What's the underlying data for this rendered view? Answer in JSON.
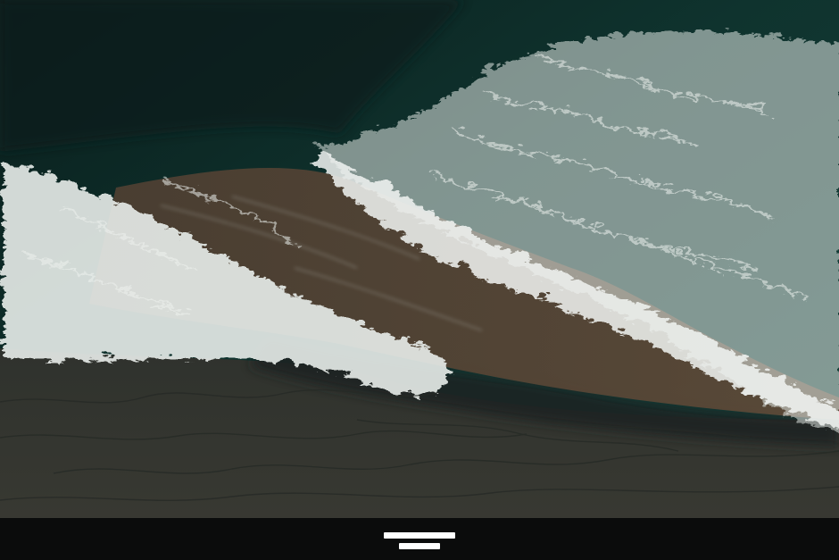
{
  "photo": {
    "subject": "aerial-ocean-waves-on-dark-sand-beach",
    "colors": {
      "deep_water": "#0b2a26",
      "shallow_water": "#15413a",
      "foam": "#e9eeeb",
      "wet_sand": "#3b3b34",
      "brown_shallows": "#5a4535"
    }
  },
  "caption": {
    "primary": "",
    "secondary": ""
  }
}
